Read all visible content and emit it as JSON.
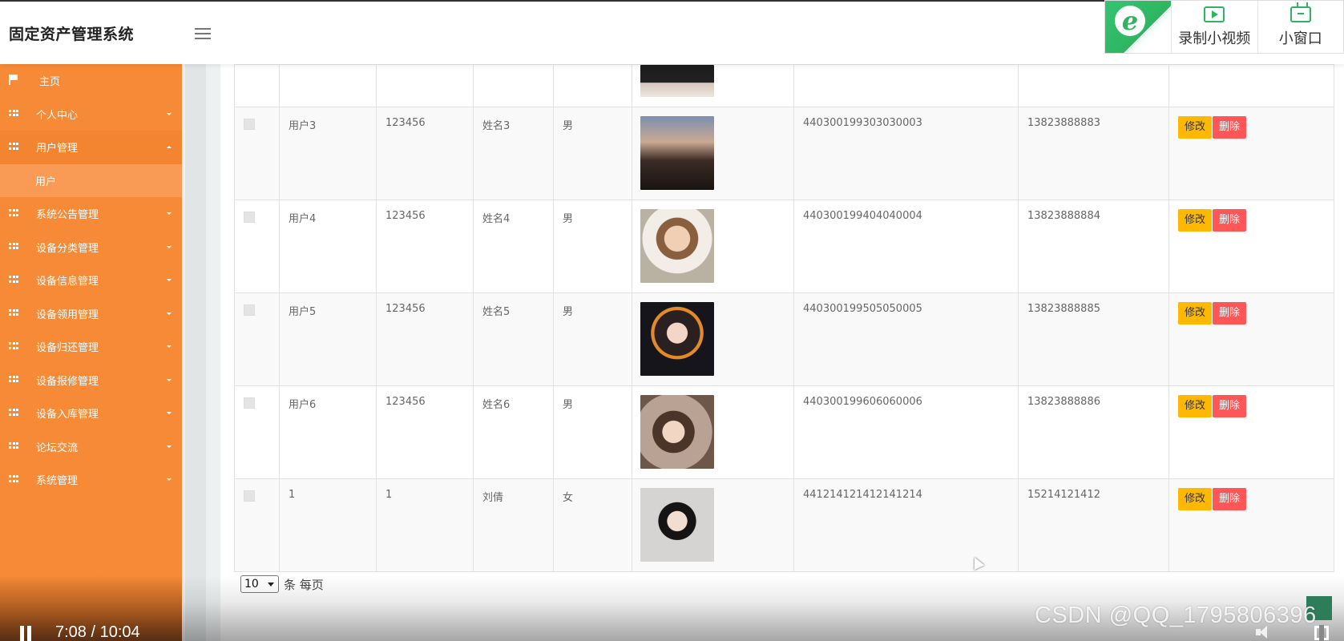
{
  "header": {
    "brand": "固定资产管理系统",
    "recorder": {
      "record_label": "录制小视频",
      "mini_label": "小窗口"
    }
  },
  "sidebar": {
    "home": "主页",
    "items": [
      {
        "label": "个人中心",
        "open": false
      },
      {
        "label": "用户管理",
        "open": true,
        "children": [
          "用户"
        ]
      },
      {
        "label": "系统公告管理",
        "open": false
      },
      {
        "label": "设备分类管理",
        "open": false
      },
      {
        "label": "设备信息管理",
        "open": false
      },
      {
        "label": "设备领用管理",
        "open": false
      },
      {
        "label": "设备归还管理",
        "open": false
      },
      {
        "label": "设备报修管理",
        "open": false
      },
      {
        "label": "设备入库管理",
        "open": false
      },
      {
        "label": "论坛交流",
        "open": false
      },
      {
        "label": "系统管理",
        "open": false
      }
    ]
  },
  "table": {
    "rows": [
      {
        "account": "用户3",
        "password": "123456",
        "name": "姓名3",
        "gender": "男",
        "id_card": "440300199303030003",
        "phone": "13823888883"
      },
      {
        "account": "用户4",
        "password": "123456",
        "name": "姓名4",
        "gender": "男",
        "id_card": "440300199404040004",
        "phone": "13823888884"
      },
      {
        "account": "用户5",
        "password": "123456",
        "name": "姓名5",
        "gender": "男",
        "id_card": "440300199505050005",
        "phone": "13823888885"
      },
      {
        "account": "用户6",
        "password": "123456",
        "name": "姓名6",
        "gender": "男",
        "id_card": "440300199606060006",
        "phone": "13823888886"
      },
      {
        "account": "1",
        "password": "1",
        "name": "刘倩",
        "gender": "女",
        "id_card": "441214121412141214",
        "phone": "15214121412"
      }
    ],
    "edit_label": "修改",
    "delete_label": "删除"
  },
  "pager": {
    "page_size": "10",
    "suffix": "条 每页"
  },
  "video": {
    "time": "7:08 / 10:04",
    "watermark": "CSDN @QQ_1795806396"
  }
}
